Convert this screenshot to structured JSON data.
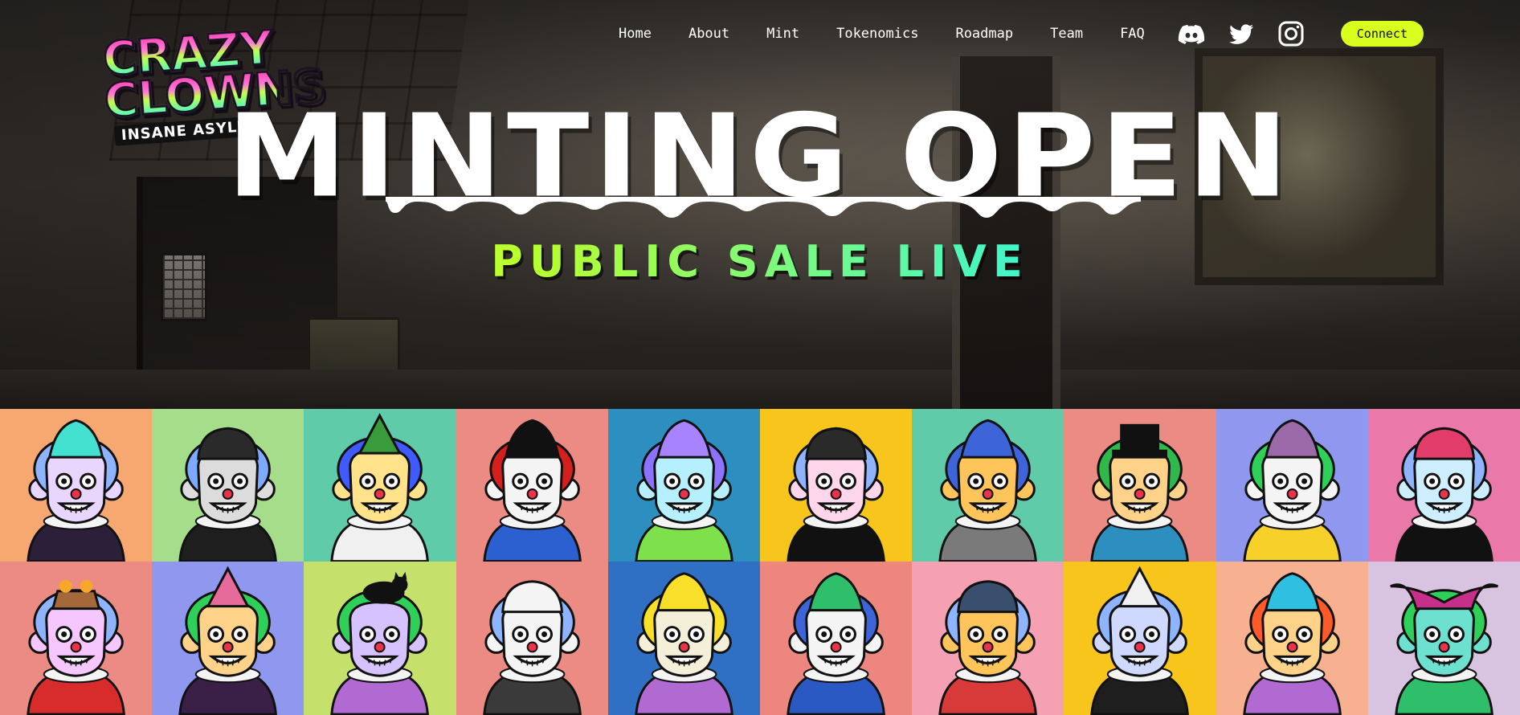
{
  "logo": {
    "line1": "CRAZY",
    "line2": "CLOWNS",
    "tagline": "INSANE ASYLUM"
  },
  "nav": {
    "links": [
      "Home",
      "About",
      "Mint",
      "Tokenomics",
      "Roadmap",
      "Team",
      "FAQ"
    ],
    "social": [
      "discord-icon",
      "twitter-icon",
      "instagram-icon"
    ],
    "connect_label": "Connect",
    "connect_color": "#d9ff1f"
  },
  "hero": {
    "title": "MINTING OPEN",
    "subtitle": "PUBLIC SALE LIVE"
  },
  "gallery": {
    "rows": [
      [
        {
          "bg": "#f7a870",
          "skin": "#e9d6ff",
          "hair": "#8fb4ff",
          "hat": "#44e0d0",
          "outfit": "#2b1f3a",
          "detail": "feathers"
        },
        {
          "bg": "#a6dd8b",
          "skin": "#dcdcdc",
          "hair": "#7fa8ff",
          "hat": "#2a2a2a",
          "outfit": "#1e1e1e",
          "detail": "chaos-cap"
        },
        {
          "bg": "#5fcba9",
          "skin": "#ffe28a",
          "hair": "#3f5aff",
          "hat": "#3a9b3a",
          "outfit": "#f0f0f0",
          "detail": "xmas-hat"
        },
        {
          "bg": "#ec8b83",
          "skin": "#f4f4f4",
          "hair": "#d41f1f",
          "hat": "#111111",
          "outfit": "#2c5fd0",
          "detail": "pigtails"
        },
        {
          "bg": "#2c8fbf",
          "skin": "#b6f0ff",
          "hair": "#8d72ff",
          "hat": "#a883ff",
          "outfit": "#7ee04a",
          "detail": "balloon"
        },
        {
          "bg": "#f7c51b",
          "skin": "#ffd6ea",
          "hair": "#8fb4ff",
          "hat": "#2a2a2a",
          "outfit": "#111111",
          "detail": "chaos-cap"
        },
        {
          "bg": "#5fcba9",
          "skin": "#ffc45a",
          "hair": "#3d64d9",
          "hat": "#3d64d9",
          "outfit": "#7a7a7a",
          "detail": "mop"
        },
        {
          "bg": "#ec8b83",
          "skin": "#ffd28a",
          "hair": "#2fb94a",
          "hat": "#111111",
          "outfit": "#2c8fbf",
          "detail": "top-hat"
        },
        {
          "bg": "#8f98ee",
          "skin": "#f4f4f4",
          "hair": "#2fd05a",
          "hat": "#9c6aa8",
          "outfit": "#f7d12a",
          "detail": "spikes"
        },
        {
          "bg": "#ea78a8",
          "skin": "#cdeeff",
          "hair": "#8fb4ff",
          "hat": "#e23c6a",
          "outfit": "#111111",
          "detail": "beanie"
        }
      ],
      [
        {
          "bg": "#ec8b83",
          "skin": "#f5c6ff",
          "hair": "#8fb4ff",
          "hat": "#a4683a",
          "outfit": "#d82b2b",
          "detail": "flower-pot"
        },
        {
          "bg": "#8f98ee",
          "skin": "#ffd28a",
          "hair": "#2fd05a",
          "hat": "#e66a9a",
          "outfit": "#3a1f46",
          "detail": "party-hat"
        },
        {
          "bg": "#c6e06c",
          "skin": "#d6c2ff",
          "hair": "#2fd05a",
          "hat": "#111111",
          "outfit": "#b06ad1",
          "detail": "black-cat"
        },
        {
          "bg": "#ec8b83",
          "skin": "#f4f4f4",
          "hair": "#8fb4ff",
          "hat": "#f4f4f4",
          "outfit": "#3a3a3a",
          "detail": "chef-hat"
        },
        {
          "bg": "#2f6fc4",
          "skin": "#f4efd8",
          "hair": "#f7df2a",
          "hat": "#f7df2a",
          "outfit": "#b06ad1",
          "detail": "spiky-hair"
        },
        {
          "bg": "#ee8680",
          "skin": "#f4f4f4",
          "hair": "#3d64d9",
          "hat": "#2fbf6a",
          "outfit": "#2a59c4",
          "detail": "afro"
        },
        {
          "bg": "#f6a0b4",
          "skin": "#ffc45a",
          "hair": "#8fb4ff",
          "hat": "#3a4f6e",
          "outfit": "#d83a3a",
          "detail": "beret"
        },
        {
          "bg": "#f7c51b",
          "skin": "#cfd8ff",
          "hair": "#8fb4ff",
          "hat": "#f0f0f0",
          "outfit": "#1e1e1e",
          "detail": "cone-hat"
        },
        {
          "bg": "#f7b090",
          "skin": "#ffd28a",
          "hair": "#ff5a2a",
          "hat": "#2fbfe0",
          "outfit": "#b06ad1",
          "detail": "rainbow-afro"
        },
        {
          "bg": "#d8c4e0",
          "skin": "#6ee0d0",
          "hair": "#2fd05a",
          "hat": "#c62f8a",
          "outfit": "#2fbf6a",
          "detail": "jester-hat"
        }
      ]
    ]
  }
}
